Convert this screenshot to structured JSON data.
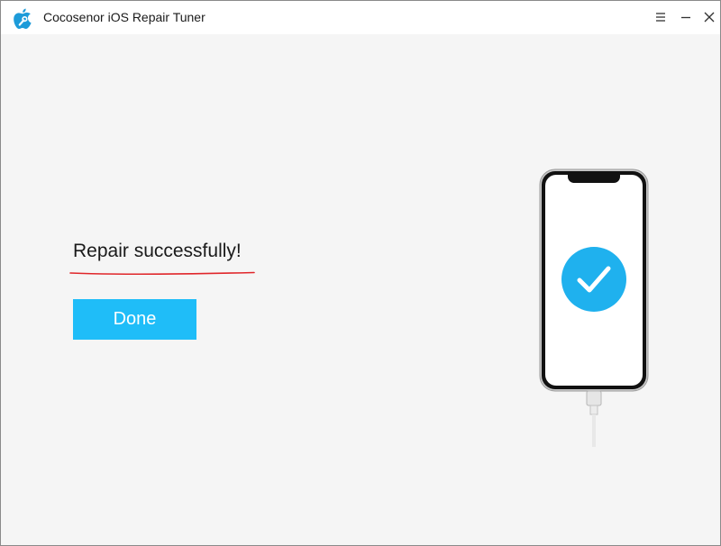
{
  "window": {
    "title": "Cocosenor iOS Repair Tuner",
    "app_icon": "apple-wrench-logo-icon",
    "controls": [
      "menu-icon",
      "minimize-icon",
      "close-icon"
    ]
  },
  "main": {
    "status_text": "Repair successfully!",
    "done_label": "Done",
    "illustration": "phone-check-icon"
  },
  "colors": {
    "accent": "#1fbdf8",
    "underline": "#e0262a",
    "background": "#f5f5f5",
    "titlebar": "#ffffff"
  }
}
